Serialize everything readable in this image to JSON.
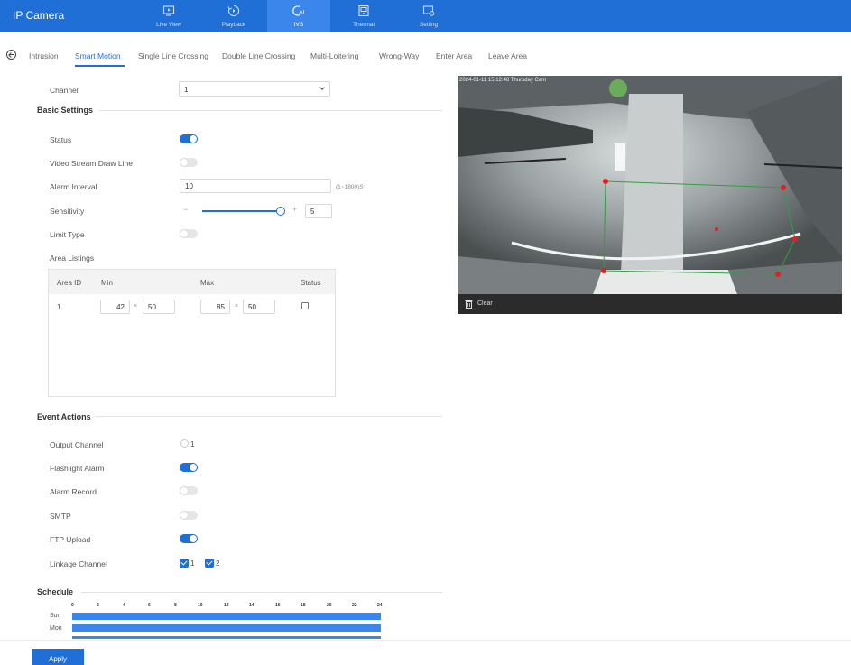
{
  "app": {
    "title": "IP Camera"
  },
  "nav": [
    {
      "label": "Live View"
    },
    {
      "label": "Playback"
    },
    {
      "label": "IVS"
    },
    {
      "label": "Thermal"
    },
    {
      "label": "Setting"
    }
  ],
  "tabs": [
    "Intrusion",
    "Smart Motion",
    "Single Line Crossing",
    "Double Line Crossing",
    "Multi-Loitering",
    "Wrong-Way",
    "Enter Area",
    "Leave Area"
  ],
  "channel": {
    "label": "Channel",
    "value": "1"
  },
  "basic": {
    "title": "Basic Settings",
    "status_label": "Status",
    "status_on": true,
    "draw_line_label": "Video Stream Draw Line",
    "draw_line_on": false,
    "alarm_interval_label": "Alarm Interval",
    "alarm_interval_value": "10",
    "alarm_interval_hint": "(1~1800)S",
    "sensitivity_label": "Sensitivity",
    "sensitivity_minus": "−",
    "sensitivity_plus": "+",
    "sensitivity_value": "5",
    "sensitivity_level": 0.8,
    "limit_type_label": "Limit Type",
    "limit_type_on": false,
    "area_listings_label": "Area Listings"
  },
  "area_table": {
    "headers": {
      "id": "Area ID",
      "min": "Min",
      "max": "Max",
      "status": "Status"
    },
    "times": "×",
    "rows": [
      {
        "id": "1",
        "min_w": "42",
        "min_h": "50",
        "max_w": "85",
        "max_h": "50",
        "status": false
      }
    ]
  },
  "events": {
    "title": "Event Actions",
    "output_channel_label": "Output Channel",
    "output_channel_value": "1",
    "flashlight_label": "Flashlight Alarm",
    "flashlight_on": true,
    "alarm_record_label": "Alarm Record",
    "alarm_record_on": false,
    "smtp_label": "SMTP",
    "smtp_on": false,
    "ftp_label": "FTP Upload",
    "ftp_on": true,
    "linkage_label": "Linkage Channel",
    "linkage_1": "1",
    "linkage_2": "2"
  },
  "video": {
    "osd": "2024-01-11 15:12:48 Thursday  Cam",
    "clear_label": "Clear"
  },
  "schedule": {
    "title": "Schedule",
    "ticks": [
      "0",
      "2",
      "4",
      "6",
      "8",
      "10",
      "12",
      "14",
      "16",
      "18",
      "20",
      "22",
      "24"
    ],
    "days": [
      "Sun",
      "Mon"
    ]
  },
  "apply_label": "Apply",
  "colors": {
    "primary": "#1f6fd6",
    "nav_active": "#3b86ea",
    "zone_line": "#2ea043",
    "zone_point": "#e02020"
  },
  "icons": [
    "live-view-icon",
    "playback-icon",
    "ivs-icon",
    "thermal-icon",
    "setting-icon",
    "back-icon",
    "trash-icon",
    "chevron-down-icon"
  ]
}
